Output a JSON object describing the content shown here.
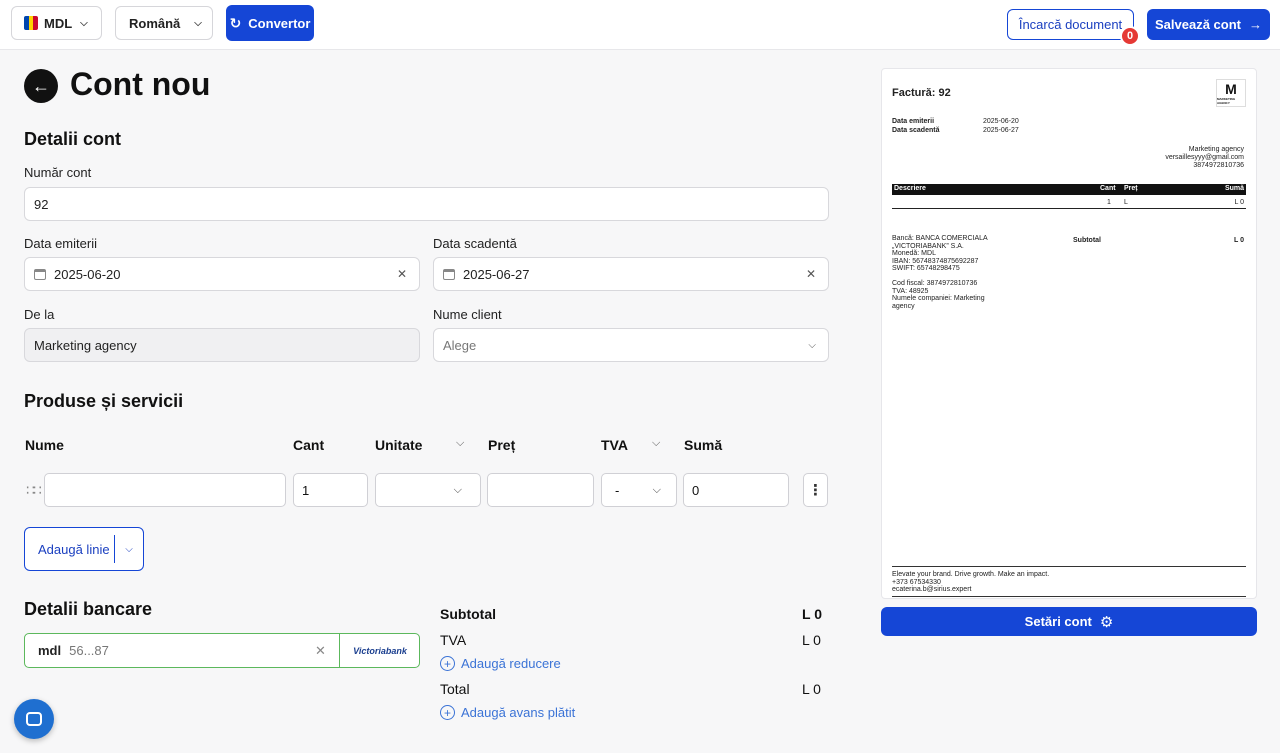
{
  "topbar": {
    "currency": "MDL",
    "language": "Română",
    "converter_label": "Convertor",
    "upload_label": "Încarcă document",
    "upload_badge": "0",
    "save_label": "Salvează cont",
    "flag_colors": [
      "#0046ae",
      "#ffd200",
      "#cc092f"
    ]
  },
  "page": {
    "title": "Cont nou"
  },
  "details": {
    "heading": "Detalii cont",
    "account_number_label": "Număr cont",
    "account_number_value": "92",
    "issue_date_label": "Data emiterii",
    "issue_date_value": "2025-06-20",
    "due_date_label": "Data scadentă",
    "due_date_value": "2025-06-27",
    "from_label": "De la",
    "from_value": "Marketing agency",
    "client_label": "Nume client",
    "client_placeholder": "Alege"
  },
  "products": {
    "heading": "Produse și servicii",
    "columns": {
      "name": "Nume",
      "qty": "Cant",
      "unit": "Unitate",
      "price": "Preț",
      "vat": "TVA",
      "sum": "Sumă"
    },
    "row": {
      "name": "",
      "qty": "1",
      "unit": "",
      "price": "",
      "vat": "-",
      "sum": "0"
    },
    "add_line_label": "Adaugă linie"
  },
  "bank": {
    "heading": "Detalii bancare",
    "currency": "mdl",
    "account_masked": "56...87",
    "bank_logo_text": "Victoriabank"
  },
  "totals": {
    "subtotal_label": "Subtotal",
    "subtotal_value": "L 0",
    "vat_label": "TVA",
    "vat_value": "L 0",
    "add_discount": "Adaugă reducere",
    "total_label": "Total",
    "total_value": "L 0",
    "add_advance": "Adaugă avans plătit"
  },
  "preview": {
    "title": "Factură: 92",
    "logo_letter": "M",
    "logo_sub": "MARKETING AGENCY",
    "issue_label": "Data emiterii",
    "issue_value": "2025-06-20",
    "due_label": "Data scadentă",
    "due_value": "2025-06-27",
    "company": [
      "Marketing agency",
      "versaillesyyy@gmail.com",
      "3874972810736"
    ],
    "table_head": {
      "desc": "Descriere",
      "qty": "Cant",
      "price": "Preț",
      "sum": "Sumă"
    },
    "table_row": {
      "qty": "1",
      "price": "L",
      "sum": "L 0"
    },
    "bank_lines": [
      "Bancă: BANCA COMERCIALA",
      "„VICTORIABANK” S.A.",
      "Monedă: MDL",
      "IBAN: 56748374875692287",
      "SWIFT: 65748298475"
    ],
    "fiscal_lines": [
      "Cod fiscal: 3874972810736",
      "TVA: 48925",
      "Numele companiei: Marketing",
      "agency"
    ],
    "subtotal_label": "Subtotal",
    "subtotal_value": "L 0",
    "footer_lines": [
      "Elevate your brand. Drive growth. Make an impact.",
      "+373 67534330",
      "ecaterina.b@sirius.expert"
    ],
    "settings_label": "Setări cont"
  }
}
